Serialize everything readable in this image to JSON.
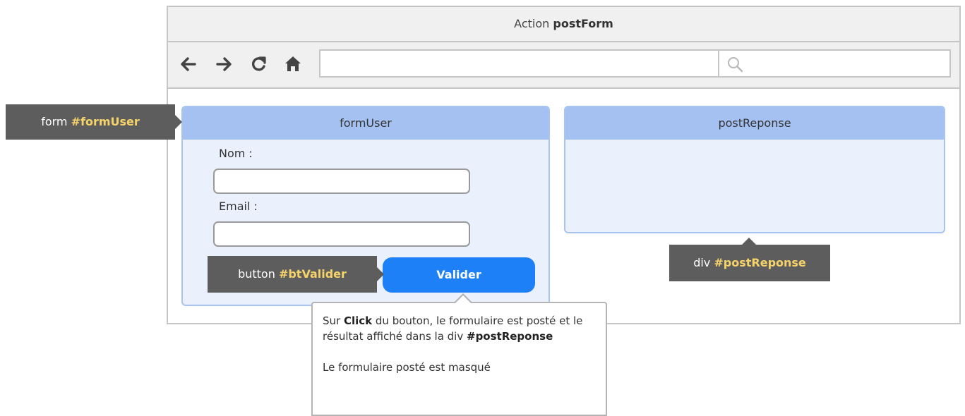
{
  "window": {
    "title_prefix": "Action",
    "title_strong": "postForm"
  },
  "toolbar": {
    "url_value": "",
    "search_value": "",
    "icons": [
      "back-arrow-icon",
      "forward-arrow-icon",
      "reload-icon",
      "home-icon",
      "search-icon"
    ]
  },
  "form_panel": {
    "title": "formUser",
    "nom_label": "Nom :",
    "nom_value": "",
    "email_label": "Email :",
    "email_value": "",
    "submit_label": "Valider"
  },
  "response_panel": {
    "title": "postReponse"
  },
  "callouts": {
    "form": {
      "prefix": "form",
      "id": "#formUser"
    },
    "button": {
      "prefix": "button",
      "id": "#btValider"
    },
    "div": {
      "prefix": "div",
      "id": "#postReponse"
    }
  },
  "note": {
    "line1_a": "Sur ",
    "line1_strong": "Click",
    "line1_b": " du bouton, le formulaire est posté et le résultat affiché dans la div ",
    "line1_strong2": "#postReponse",
    "line2": "Le formulaire posté est masqué"
  },
  "colors": {
    "panel_header": "#a4c1f2",
    "panel_body": "#eaf1fd",
    "button": "#1e80f7",
    "callout_bg": "#5d5d5d",
    "callout_highlight": "#f5d36a"
  }
}
